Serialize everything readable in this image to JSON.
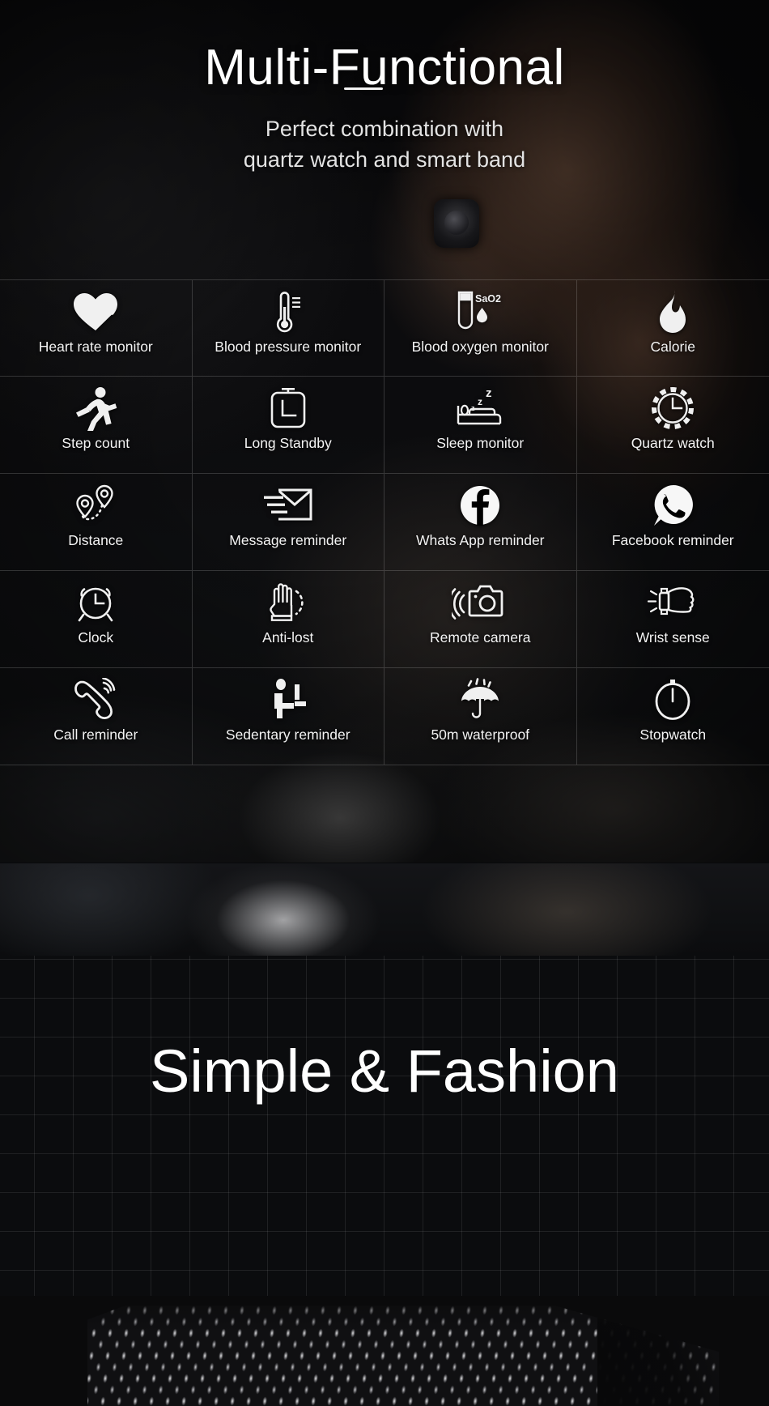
{
  "hero": {
    "title": "Multi-Functional",
    "subtitle_line1": "Perfect combination with",
    "subtitle_line2": "quartz watch and smart band"
  },
  "features": [
    {
      "label": "Heart rate monitor",
      "icon": "heart-pulse-icon"
    },
    {
      "label": "Blood pressure monitor",
      "icon": "thermometer-icon"
    },
    {
      "label": "Blood oxygen monitor",
      "icon": "test-tube-sao2-icon",
      "icon_text": "SaO2"
    },
    {
      "label": "Calorie",
      "icon": "flame-icon"
    },
    {
      "label": "Step count",
      "icon": "running-person-icon"
    },
    {
      "label": "Long Standby",
      "icon": "battery-clock-icon"
    },
    {
      "label": "Sleep monitor",
      "icon": "bed-zzz-icon",
      "icon_text": "zzz"
    },
    {
      "label": "Quartz watch",
      "icon": "quartz-dial-icon"
    },
    {
      "label": "Distance",
      "icon": "map-pins-path-icon"
    },
    {
      "label": "Message reminder",
      "icon": "envelope-speed-icon"
    },
    {
      "label": "Whats App reminder",
      "icon": "facebook-circle-icon"
    },
    {
      "label": "Facebook reminder",
      "icon": "whatsapp-bubble-icon"
    },
    {
      "label": "Clock",
      "icon": "alarm-clock-icon"
    },
    {
      "label": "Anti-lost",
      "icon": "open-hand-icon"
    },
    {
      "label": "Remote camera",
      "icon": "camera-wireless-icon"
    },
    {
      "label": "Wrist sense",
      "icon": "wrist-watch-fist-icon"
    },
    {
      "label": "Call reminder",
      "icon": "phone-ringing-icon"
    },
    {
      "label": "Sedentary reminder",
      "icon": "sitting-person-icon"
    },
    {
      "label": "50m waterproof",
      "icon": "umbrella-rain-icon"
    },
    {
      "label": "Stopwatch",
      "icon": "stopwatch-icon"
    }
  ],
  "fashion": {
    "title": "Simple & Fashion"
  },
  "colors": {
    "background": "#08090b",
    "text": "#ffffff",
    "grid_line": "rgba(255,255,255,0.17)",
    "paper_grid_line": "rgba(255,255,255,0.085)"
  }
}
